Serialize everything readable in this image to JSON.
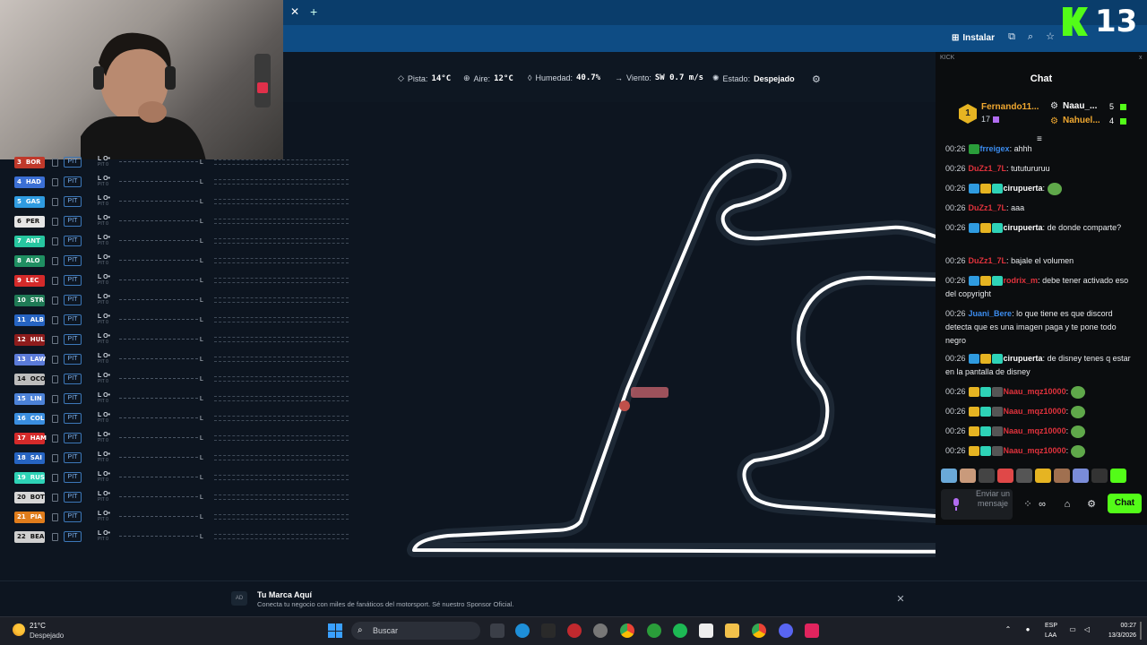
{
  "browser": {
    "install_label": "Instalar",
    "brand_number": "13"
  },
  "weather": {
    "track_label": "Pista:",
    "track_value": "14°C",
    "air_label": "Aire:",
    "air_value": "12°C",
    "humidity_label": "Humedad:",
    "humidity_value": "40.7%",
    "wind_label": "Viento:",
    "wind_value": "SW 0.7 m/s",
    "status_label": "Estado:",
    "status_value": "Despejado"
  },
  "timing": {
    "pit_label": "PIT",
    "lo_label": "L O•",
    "pit0_label": "PIT 0",
    "lap_label": "L",
    "drivers": [
      {
        "pos": "3",
        "code": "BOR",
        "color": "#c0392b"
      },
      {
        "pos": "4",
        "code": "HAD",
        "color": "#3b6fd4"
      },
      {
        "pos": "5",
        "code": "GAS",
        "color": "#2f9be0"
      },
      {
        "pos": "6",
        "code": "PER",
        "color": "#e6e6e6"
      },
      {
        "pos": "7",
        "code": "ANT",
        "color": "#27c6a0"
      },
      {
        "pos": "8",
        "code": "ALO",
        "color": "#1f8f62"
      },
      {
        "pos": "9",
        "code": "LEC",
        "color": "#d42a2a"
      },
      {
        "pos": "10",
        "code": "STR",
        "color": "#1f7a55"
      },
      {
        "pos": "11",
        "code": "ALB",
        "color": "#2664c2"
      },
      {
        "pos": "12",
        "code": "HUL",
        "color": "#8e1c1c"
      },
      {
        "pos": "13",
        "code": "LAW",
        "color": "#5b7bd9"
      },
      {
        "pos": "14",
        "code": "OCO",
        "color": "#bcbcbc"
      },
      {
        "pos": "15",
        "code": "LIN",
        "color": "#4c82d8"
      },
      {
        "pos": "16",
        "code": "COL",
        "color": "#3a8ee0"
      },
      {
        "pos": "17",
        "code": "HAM",
        "color": "#d42a2a"
      },
      {
        "pos": "18",
        "code": "SAI",
        "color": "#2664c2"
      },
      {
        "pos": "19",
        "code": "RUS",
        "color": "#2ed3b7"
      },
      {
        "pos": "20",
        "code": "BOT",
        "color": "#d6d6d6"
      },
      {
        "pos": "21",
        "code": "PIA",
        "color": "#e07d1c"
      },
      {
        "pos": "22",
        "code": "BEA",
        "color": "#cfcfcf"
      }
    ]
  },
  "chat": {
    "source_label": "KICK",
    "close_label": "x",
    "title": "Chat",
    "leaderboard": {
      "rank": "1",
      "first_name": "Fernando11...",
      "first_count": "17",
      "second_name": "Naau_...",
      "second_count": "5",
      "third_name": "Nahuel...",
      "third_count": "4"
    },
    "messages": [
      {
        "time": "00:26",
        "user": "frreigex",
        "user_color": "#3c8df0",
        "text": "ahhh"
      },
      {
        "time": "00:26",
        "user": "DuZz1_7L",
        "user_color": "#e0323c",
        "text": "tututururuu"
      },
      {
        "time": "00:26",
        "user": "cirupuerta",
        "user_color": "#ffffff",
        "text": ""
      },
      {
        "time": "00:26",
        "user": "DuZz1_7L",
        "user_color": "#e0323c",
        "text": "aaa"
      },
      {
        "time": "00:26",
        "user": "cirupuerta",
        "user_color": "#ffffff",
        "text": "de donde comparte?"
      },
      {
        "time": "00:26",
        "user": "DuZz1_7L",
        "user_color": "#e0323c",
        "text": "bajale el volumen"
      },
      {
        "time": "00:26",
        "user": "rodrix_m",
        "user_color": "#e0323c",
        "text": "debe tener activado eso del copyright"
      },
      {
        "time": "00:26",
        "user": "Juani_Bere",
        "user_color": "#3c8df0",
        "text": "lo que tiene es que discord detecta que es una imagen paga y te pone todo negro"
      },
      {
        "time": "00:26",
        "user": "cirupuerta",
        "user_color": "#ffffff",
        "text": "de disney tenes q estar en la pantalla de disney"
      },
      {
        "time": "00:26",
        "user": "Naau_mqz10000",
        "user_color": "#e0323c",
        "text": ""
      },
      {
        "time": "00:26",
        "user": "Naau_mqz10000",
        "user_color": "#e0323c",
        "text": ""
      },
      {
        "time": "00:26",
        "user": "Naau_mqz10000",
        "user_color": "#e0323c",
        "text": ""
      },
      {
        "time": "00:26",
        "user": "Naau_mqz10000",
        "user_color": "#e0323c",
        "text": ""
      }
    ],
    "input_placeholder": "Enviar un mensaje",
    "send_label": "Chat"
  },
  "ad": {
    "tag": "AD",
    "title": "Tu Marca Aquí",
    "text": "Conecta tu negocio con miles de fanáticos del motorsport. Sé nuestro Sponsor Oficial."
  },
  "taskbar": {
    "weather_temp": "21°C",
    "weather_desc": "Despejado",
    "search_label": "Buscar",
    "lang_top": "ESP",
    "lang_bottom": "LAA",
    "time": "00:27",
    "date": "13/3/2026"
  },
  "colors": {
    "accent": "#53fc18",
    "chrome": "#0e4c84",
    "background": "#0d1520"
  }
}
